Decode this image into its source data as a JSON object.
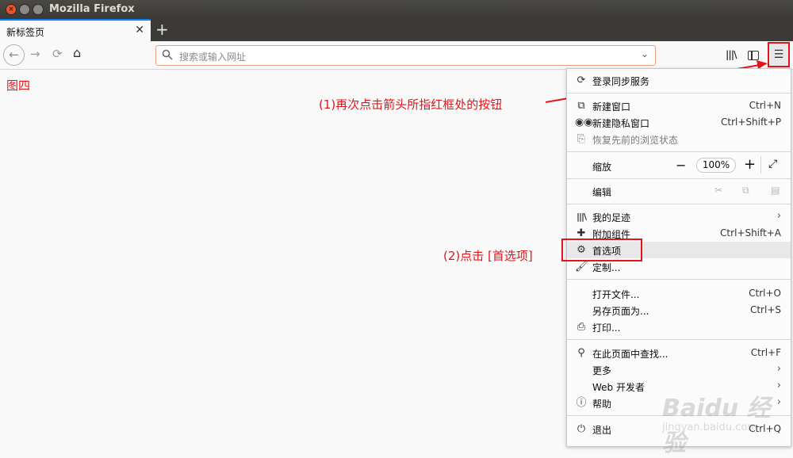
{
  "window": {
    "title": "Mozilla Firefox"
  },
  "tab": {
    "label": "新标签页",
    "close": "✕",
    "new_tab": "+"
  },
  "urlbar": {
    "placeholder": "搜索或输入网址"
  },
  "annotations": {
    "figure": "图四",
    "step1": "(1)再次点击箭头所指红框处的按钮",
    "step2": "(2)点击 [首选项]"
  },
  "menu": {
    "sync": "登录同步服务",
    "new_window": {
      "label": "新建窗口",
      "shortcut": "Ctrl+N"
    },
    "private_window": {
      "label": "新建隐私窗口",
      "shortcut": "Ctrl+Shift+P"
    },
    "restore": "恢复先前的浏览状态",
    "zoom": {
      "label": "缩放",
      "value": "100%",
      "minus": "−",
      "plus": "+"
    },
    "edit": "编辑",
    "library": "我的足迹",
    "addons": {
      "label": "附加组件",
      "shortcut": "Ctrl+Shift+A"
    },
    "preferences": "首选项",
    "customize": "定制...",
    "open_file": {
      "label": "打开文件...",
      "shortcut": "Ctrl+O"
    },
    "save_as": {
      "label": "另存页面为...",
      "shortcut": "Ctrl+S"
    },
    "print": "打印...",
    "find": {
      "label": "在此页面中查找...",
      "shortcut": "Ctrl+F"
    },
    "more": "更多",
    "web_dev": "Web 开发者",
    "help": "帮助",
    "quit": {
      "label": "退出",
      "shortcut": "Ctrl+Q"
    }
  },
  "watermark": {
    "text": "Baidu 经验",
    "url": "jingyan.baidu.com"
  },
  "colors": {
    "annotation_red": "#e2151a",
    "focus_blue": "#0a84ff"
  }
}
